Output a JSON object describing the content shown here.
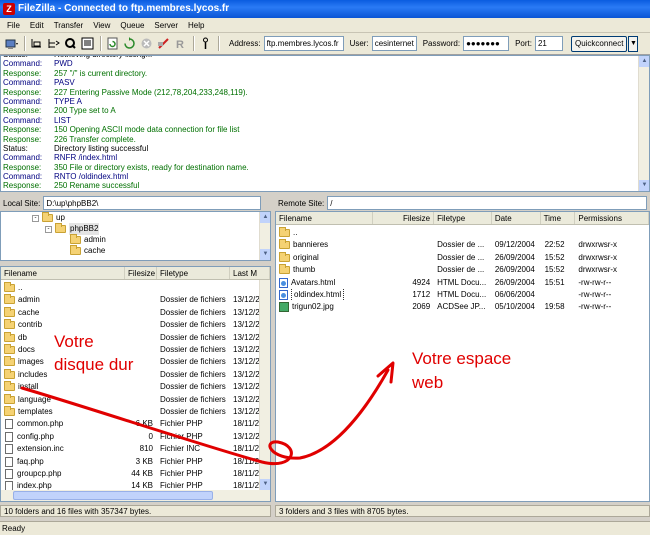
{
  "window": {
    "title": "FileZilla - Connected to ftp.membres.lycos.fr",
    "app_icon": "Z"
  },
  "menu": [
    "File",
    "Edit",
    "Transfer",
    "View",
    "Queue",
    "Server",
    "Help"
  ],
  "toolbar": {
    "address_label": "Address:",
    "address_value": "ftp.membres.lycos.fr",
    "user_label": "User:",
    "user_value": "cesinternet",
    "password_label": "Password:",
    "password_value": "●●●●●●●",
    "port_label": "Port:",
    "port_value": "21",
    "quickconnect_label": "Quickconnect"
  },
  "log": [
    {
      "type": "Status:",
      "msg": "Retrieving directory listing...",
      "kind": "status"
    },
    {
      "type": "Command:",
      "msg": "PWD",
      "kind": "command"
    },
    {
      "type": "Response:",
      "msg": "257 \"/\" is current directory.",
      "kind": "response"
    },
    {
      "type": "Command:",
      "msg": "PASV",
      "kind": "command"
    },
    {
      "type": "Response:",
      "msg": "227 Entering Passive Mode (212,78,204,233,248,119).",
      "kind": "response"
    },
    {
      "type": "Command:",
      "msg": "TYPE A",
      "kind": "command"
    },
    {
      "type": "Response:",
      "msg": "200 Type set to A",
      "kind": "response"
    },
    {
      "type": "Command:",
      "msg": "LIST",
      "kind": "command"
    },
    {
      "type": "Response:",
      "msg": "150 Opening ASCII mode data connection for file list",
      "kind": "response"
    },
    {
      "type": "Response:",
      "msg": "226 Transfer complete.",
      "kind": "response"
    },
    {
      "type": "Status:",
      "msg": "Directory listing successful",
      "kind": "status"
    },
    {
      "type": "Command:",
      "msg": "RNFR /index.html",
      "kind": "command"
    },
    {
      "type": "Response:",
      "msg": "350 File or directory exists, ready for destination name.",
      "kind": "response"
    },
    {
      "type": "Command:",
      "msg": "RNTO /oldindex.html",
      "kind": "command"
    },
    {
      "type": "Response:",
      "msg": "250 Rename successful",
      "kind": "response"
    }
  ],
  "local": {
    "site_label": "Local Site:",
    "site_path": "D:\\up\\phpBB2\\",
    "tree": [
      {
        "name": "up",
        "level": 0
      },
      {
        "name": "phpBB2",
        "level": 1
      },
      {
        "name": "admin",
        "level": 2
      },
      {
        "name": "cache",
        "level": 2
      }
    ],
    "columns": [
      "Filename",
      "Filesize",
      "Filetype",
      "Last M"
    ],
    "rows": [
      {
        "name": "..",
        "size": "",
        "type": "",
        "date": "",
        "icon": "folder"
      },
      {
        "name": "admin",
        "size": "",
        "type": "Dossier de fichiers",
        "date": "13/12/2",
        "icon": "folder"
      },
      {
        "name": "cache",
        "size": "",
        "type": "Dossier de fichiers",
        "date": "13/12/2",
        "icon": "folder"
      },
      {
        "name": "contrib",
        "size": "",
        "type": "Dossier de fichiers",
        "date": "13/12/2",
        "icon": "folder"
      },
      {
        "name": "db",
        "size": "",
        "type": "Dossier de fichiers",
        "date": "13/12/2",
        "icon": "folder"
      },
      {
        "name": "docs",
        "size": "",
        "type": "Dossier de fichiers",
        "date": "13/12/2",
        "icon": "folder"
      },
      {
        "name": "images",
        "size": "",
        "type": "Dossier de fichiers",
        "date": "13/12/2",
        "icon": "folder"
      },
      {
        "name": "includes",
        "size": "",
        "type": "Dossier de fichiers",
        "date": "13/12/2",
        "icon": "folder"
      },
      {
        "name": "install",
        "size": "",
        "type": "Dossier de fichiers",
        "date": "13/12/2",
        "icon": "folder"
      },
      {
        "name": "language",
        "size": "",
        "type": "Dossier de fichiers",
        "date": "13/12/2",
        "icon": "folder"
      },
      {
        "name": "templates",
        "size": "",
        "type": "Dossier de fichiers",
        "date": "13/12/2",
        "icon": "folder"
      },
      {
        "name": "common.php",
        "size": "6 KB",
        "type": "Fichier PHP",
        "date": "18/11/2",
        "icon": "file"
      },
      {
        "name": "config.php",
        "size": "0",
        "type": "Fichier PHP",
        "date": "13/12/2",
        "icon": "file"
      },
      {
        "name": "extension.inc",
        "size": "810",
        "type": "Fichier INC",
        "date": "18/11/2",
        "icon": "file"
      },
      {
        "name": "faq.php",
        "size": "3 KB",
        "type": "Fichier PHP",
        "date": "18/11/2",
        "icon": "file"
      },
      {
        "name": "groupcp.php",
        "size": "44 KB",
        "type": "Fichier PHP",
        "date": "18/11/2",
        "icon": "file"
      },
      {
        "name": "index.php",
        "size": "14 KB",
        "type": "Fichier PHP",
        "date": "18/11/2",
        "icon": "file"
      }
    ],
    "summary": "10 folders and 16 files with 357347 bytes."
  },
  "remote": {
    "site_label": "Remote Site:",
    "site_path": "/",
    "columns": [
      "Filename",
      "Filesize",
      "Filetype",
      "Date",
      "Time",
      "Permissions"
    ],
    "rows": [
      {
        "name": "..",
        "size": "",
        "type": "",
        "date": "",
        "time": "",
        "perm": "",
        "icon": "folder"
      },
      {
        "name": "bannieres",
        "size": "",
        "type": "Dossier de ...",
        "date": "09/12/2004",
        "time": "22:52",
        "perm": "drwxrwsr-x",
        "icon": "folder"
      },
      {
        "name": "original",
        "size": "",
        "type": "Dossier de ...",
        "date": "26/09/2004",
        "time": "15:52",
        "perm": "drwxrwsr-x",
        "icon": "folder"
      },
      {
        "name": "thumb",
        "size": "",
        "type": "Dossier de ...",
        "date": "26/09/2004",
        "time": "15:52",
        "perm": "drwxrwsr-x",
        "icon": "folder"
      },
      {
        "name": "Avatars.html",
        "size": "4924",
        "type": "HTML Docu...",
        "date": "26/09/2004",
        "time": "15:51",
        "perm": "-rw-rw-r--",
        "icon": "html"
      },
      {
        "name": "oldindex.html",
        "size": "1712",
        "type": "HTML Docu...",
        "date": "06/06/2004",
        "time": "",
        "perm": "-rw-rw-r--",
        "icon": "html",
        "selected": true
      },
      {
        "name": "trigun02.jpg",
        "size": "2069",
        "type": "ACDSee JP...",
        "date": "05/10/2004",
        "time": "19:58",
        "perm": "-rw-rw-r--",
        "icon": "jpg"
      }
    ],
    "summary": "3 folders and 3 files with 8705 bytes."
  },
  "status": "Ready",
  "annotations": {
    "left_line1": "Votre",
    "left_line2": "disque dur",
    "right_line1": "Votre espace",
    "right_line2": "web",
    "color": "#e00000"
  }
}
